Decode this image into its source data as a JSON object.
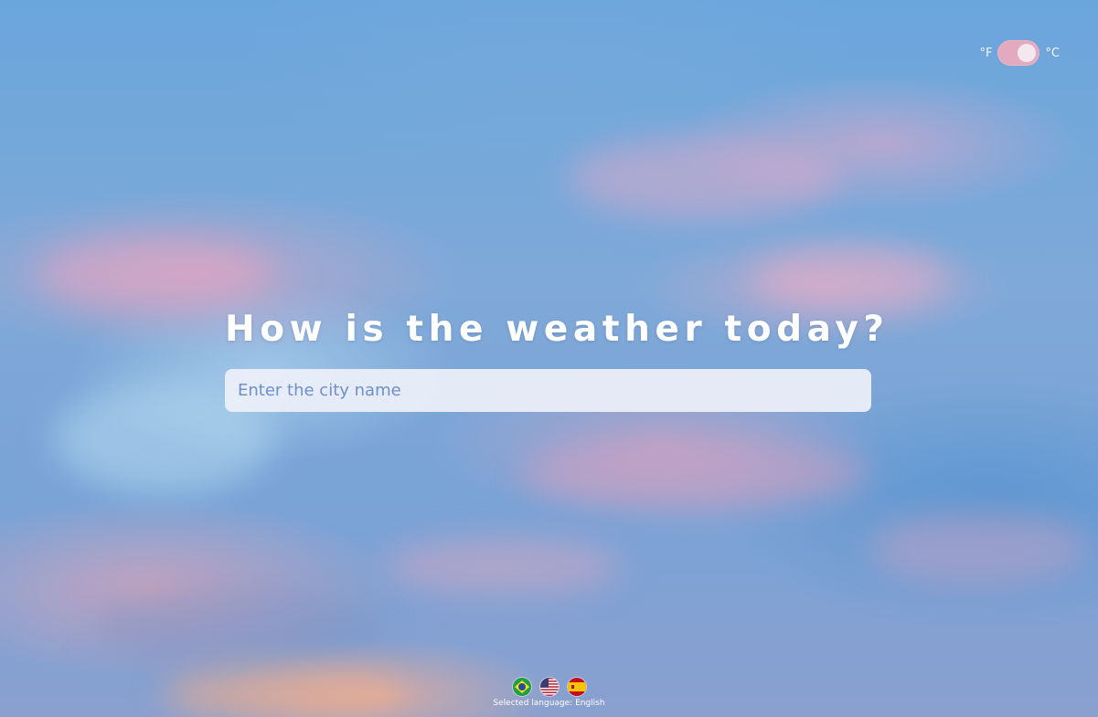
{
  "units": {
    "fahrenheit_label": "°F",
    "celsius_label": "°C",
    "selected": "celsius"
  },
  "hero": {
    "title": "How is the weather today?"
  },
  "search": {
    "placeholder": "Enter the city name",
    "value": ""
  },
  "language": {
    "flags": [
      {
        "name": "brazil-flag-icon",
        "lang": "Portuguese"
      },
      {
        "name": "usa-flag-icon",
        "lang": "English"
      },
      {
        "name": "spain-flag-icon",
        "lang": "Spanish"
      }
    ],
    "selected_caption": "Selected language: English"
  },
  "colors": {
    "toggle_track": "#e3a9bf",
    "input_bg": "#eef0f8",
    "input_text": "#6f8fc6"
  }
}
